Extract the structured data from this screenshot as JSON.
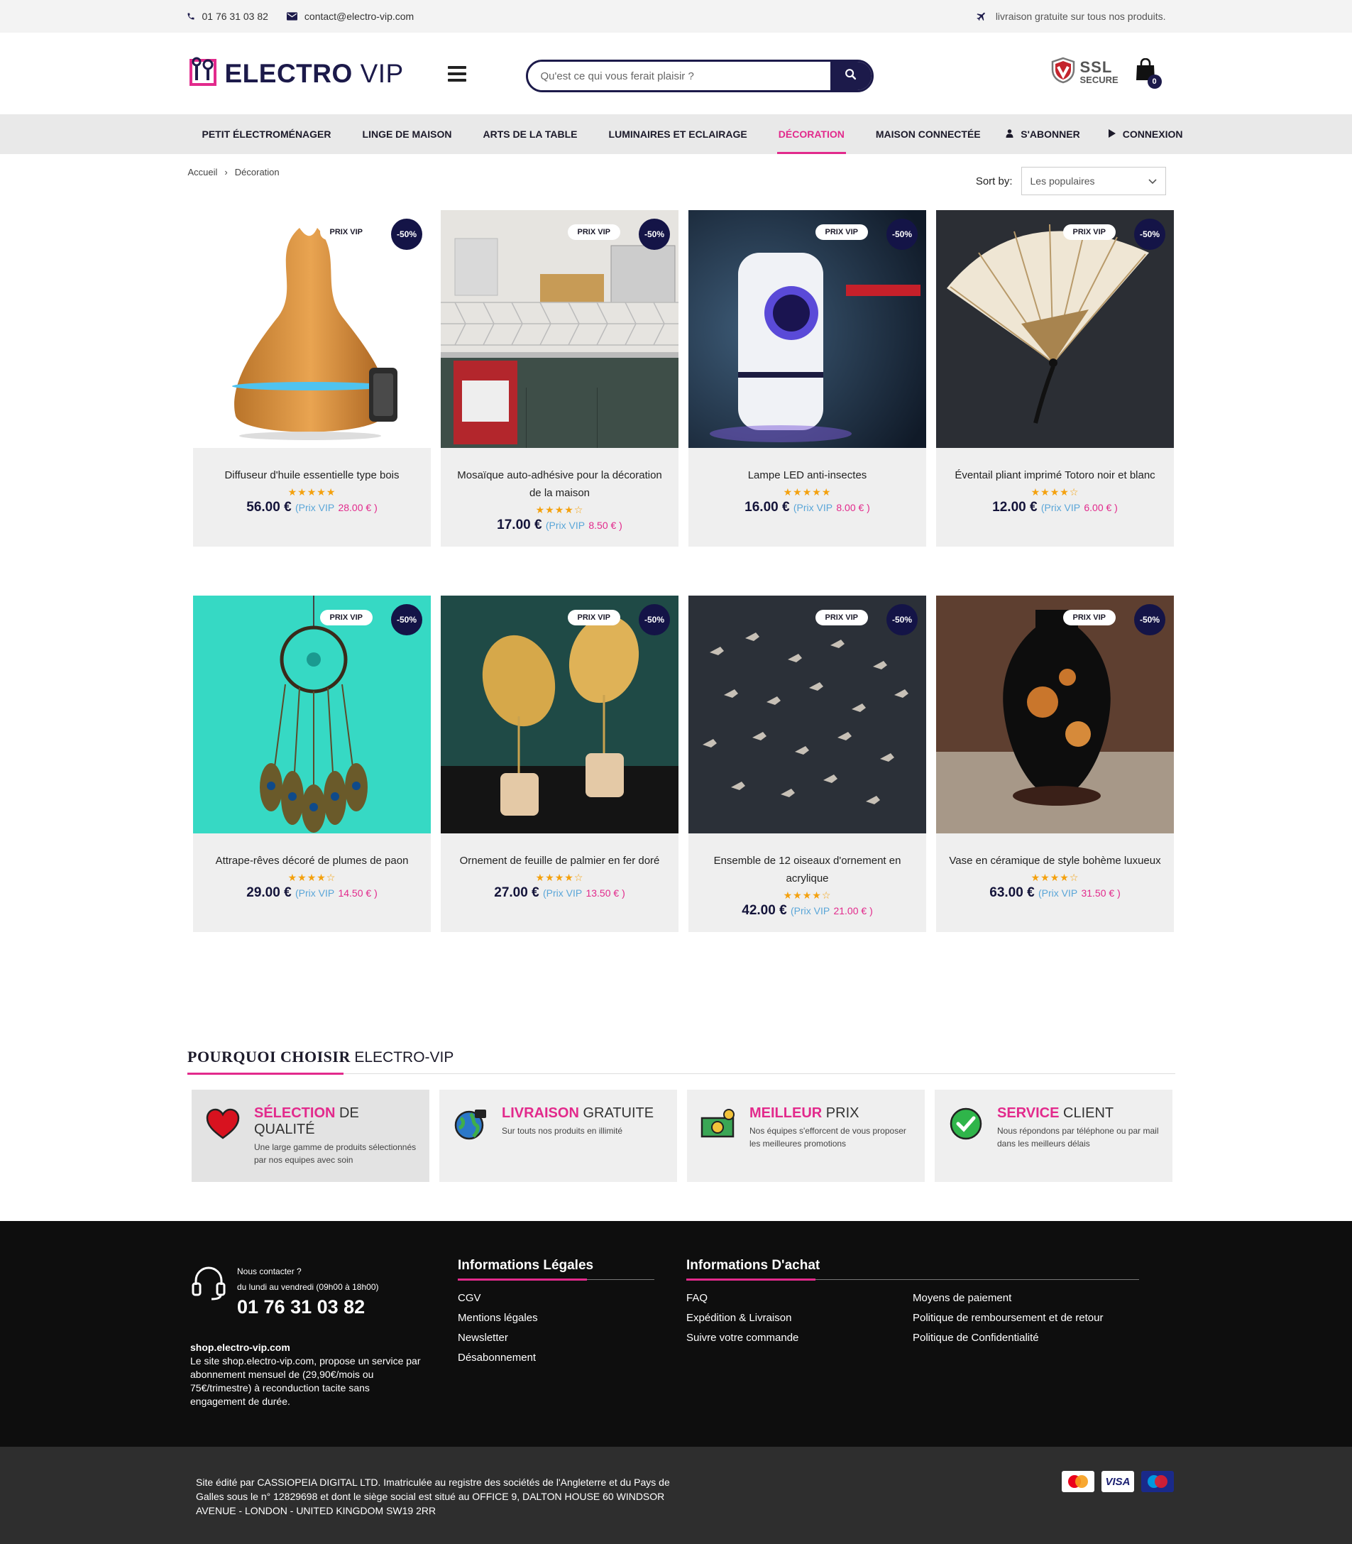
{
  "topbar": {
    "phone": "01 76 31 03 82",
    "email": "contact@electro-vip.com",
    "shipping": "livraison gratuite sur tous nos produits."
  },
  "header": {
    "logo_main": "ELECTRO",
    "logo_vip": "VIP",
    "search_placeholder": "Qu'est ce qui vous ferait plaisir ?",
    "ssl_big": "SSL",
    "ssl_small": "SECURE",
    "cart_count": "0"
  },
  "nav": {
    "items": [
      {
        "label": "PETIT ÉLECTROMÉNAGER"
      },
      {
        "label": "LINGE DE MAISON"
      },
      {
        "label": "ARTS DE LA TABLE"
      },
      {
        "label": "LUMINAIRES ET ECLAIRAGE"
      },
      {
        "label": "DÉCORATION",
        "active": true
      },
      {
        "label": "MAISON CONNECTÉE"
      }
    ],
    "subscribe": "S'ABONNER",
    "login": "CONNEXION"
  },
  "breadcrumb": {
    "home": "Accueil",
    "separator": "›",
    "current": "Décoration"
  },
  "sort": {
    "label": "Sort by:",
    "value": "Les populaires"
  },
  "products": [
    {
      "title": "Diffuseur d'huile essentielle type bois",
      "stars": "★★★★★",
      "rating": 4.5,
      "price": "56.00 €",
      "vip_label": "(Prix VIP",
      "vip_price": "28.00 € )",
      "badge": "PRIX VIP",
      "discount": "-50%",
      "icon": "aroma-diffuser-image"
    },
    {
      "title": "Mosaïque auto-adhésive pour la décoration de la maison",
      "stars": "★★★★☆",
      "rating": 4,
      "price": "17.00 €",
      "vip_label": "(Prix VIP",
      "vip_price": "8.50 € )",
      "badge": "PRIX VIP",
      "discount": "-50%",
      "icon": "kitchen-mosaic-image"
    },
    {
      "title": "Lampe LED anti-insectes",
      "stars": "★★★★★",
      "rating": 4.5,
      "price": "16.00 €",
      "vip_label": "(Prix VIP",
      "vip_price": "8.00 € )",
      "badge": "PRIX VIP",
      "discount": "-50%",
      "icon": "led-insect-lamp-image"
    },
    {
      "title": "Éventail pliant imprimé Totoro noir et blanc",
      "stars": "★★★★☆",
      "rating": 4,
      "price": "12.00 €",
      "vip_label": "(Prix VIP",
      "vip_price": "6.00 € )",
      "badge": "PRIX VIP",
      "discount": "-50%",
      "icon": "folding-fan-image"
    },
    {
      "title": "Attrape-rêves décoré de plumes de paon",
      "stars": "★★★★☆",
      "rating": 4,
      "price": "29.00 €",
      "vip_label": "(Prix VIP",
      "vip_price": "14.50 € )",
      "badge": "PRIX VIP",
      "discount": "-50%",
      "icon": "dreamcatcher-image"
    },
    {
      "title": "Ornement de feuille de palmier en fer doré",
      "stars": "★★★★☆",
      "rating": 4,
      "price": "27.00 €",
      "vip_label": "(Prix VIP",
      "vip_price": "13.50 € )",
      "badge": "PRIX VIP",
      "discount": "-50%",
      "icon": "gold-palm-leaf-image"
    },
    {
      "title": "Ensemble de 12 oiseaux d'ornement en acrylique",
      "stars": "★★★★☆",
      "rating": 4,
      "price": "42.00 €",
      "vip_label": "(Prix VIP",
      "vip_price": "21.00 € )",
      "badge": "PRIX VIP",
      "discount": "-50%",
      "icon": "acrylic-birds-image"
    },
    {
      "title": "Vase en céramique de style bohème luxueux",
      "stars": "★★★★☆",
      "rating": 4,
      "price": "63.00 €",
      "vip_label": "(Prix VIP",
      "vip_price": "31.50 € )",
      "badge": "PRIX VIP",
      "discount": "-50%",
      "icon": "ceramic-vase-image"
    }
  ],
  "why": {
    "title_bold": "POURQUOI CHOISIR",
    "title_rest": "ELECTRO-VIP",
    "cards": [
      {
        "h_bold": "SÉLECTION",
        "h_rest": "DE QUALITÉ",
        "text": "Une large gamme de produits sélectionnés par nos equipes avec soin",
        "icon": "heart-icon"
      },
      {
        "h_bold": "LIVRAISON",
        "h_rest": "GRATUITE",
        "text": "Sur touts nos produits en illimité",
        "icon": "globe-cart-icon"
      },
      {
        "h_bold": "MEILLEUR",
        "h_rest": "PRIX",
        "text": "Nos équipes s'efforcent de vous proposer les meilleures promotions",
        "icon": "money-icon"
      },
      {
        "h_bold": "SERVICE",
        "h_rest": "CLIENT",
        "text": "Nous répondons par téléphone ou par mail dans les meilleurs délais",
        "icon": "check-circle-icon"
      }
    ]
  },
  "footer": {
    "contact_q": "Nous contacter ?",
    "contact_hours": "du lundi au vendredi (09h00 à 18h00)",
    "contact_phone": "01 76 31 03 82",
    "site_name": "shop.electro-vip.com",
    "site_text": "Le site shop.electro-vip.com, propose un service par abonnement mensuel de (29,90€/mois ou 75€/trimestre) à reconduction tacite sans engagement de durée.",
    "legal_title": "Informations Légales",
    "legal_links": [
      "CGV",
      "Mentions légales",
      "Newsletter",
      "Désabonnement"
    ],
    "purchase_title": "Informations D'achat",
    "purchase_links_a": [
      "FAQ",
      "Expédition & Livraison",
      "Suivre votre commande"
    ],
    "purchase_links_b": [
      "Moyens de paiement",
      "Politique de remboursement et de retour",
      "Politique de Confidentialité"
    ],
    "legal_text": "Site édité par CASSIOPEIA DIGITAL LTD. Imatriculée au registre des sociétés de l'Angleterre et du Pays de Galles sous le n° 12829698 et dont le siège social est situé au OFFICE 9, DALTON HOUSE 60 WINDSOR AVENUE - LONDON - UNITED KINGDOM SW19 2RR",
    "payments": [
      "MasterCard",
      "VISA",
      "Maestro"
    ]
  },
  "colors": {
    "accent": "#e22a8c",
    "navy": "#1c1a4a",
    "vip_blue": "#5aa6d8",
    "star": "#f4a10e"
  }
}
